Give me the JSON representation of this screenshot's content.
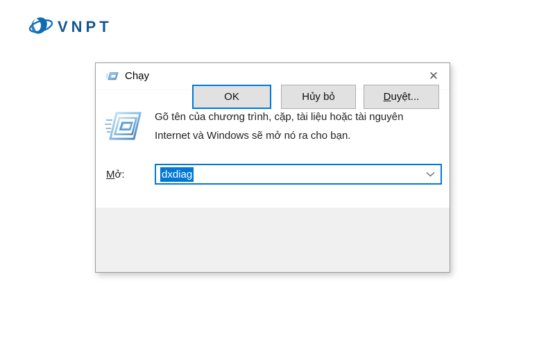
{
  "brand": {
    "name": "VNPT",
    "logo_icon": "vnpt-globe",
    "logo_icon_color": "#0e6cb4",
    "logo_text_color": "#14568f"
  },
  "dialog": {
    "title": "Chạy",
    "title_icon": "run-window",
    "message_lines": [
      "Gõ tên của chương trình, cặp, tài liệu hoặc tài nguyên",
      "Internet và Windows sẽ mở nó ra cho bạn."
    ],
    "open_field": {
      "label_accesskey": "M",
      "label_rest": "ở:",
      "value": "dxdiag",
      "value_selected": true,
      "dropdown_icon": "chevron-down"
    },
    "buttons": {
      "ok": "OK",
      "cancel": "Hủy bỏ",
      "browse_accesskey": "D",
      "browse_rest": "uyệt..."
    }
  },
  "icons": {
    "close": "✕"
  },
  "colors": {
    "accent": "#0078d7",
    "selection_bg": "#0078d7",
    "selection_text": "#ffffff",
    "footer_bg": "#f0f0f0",
    "button_bg": "#e1e1e1",
    "button_border": "#adadad",
    "dialog_border": "#9b9b9b",
    "body_text": "#1f1f1f"
  }
}
